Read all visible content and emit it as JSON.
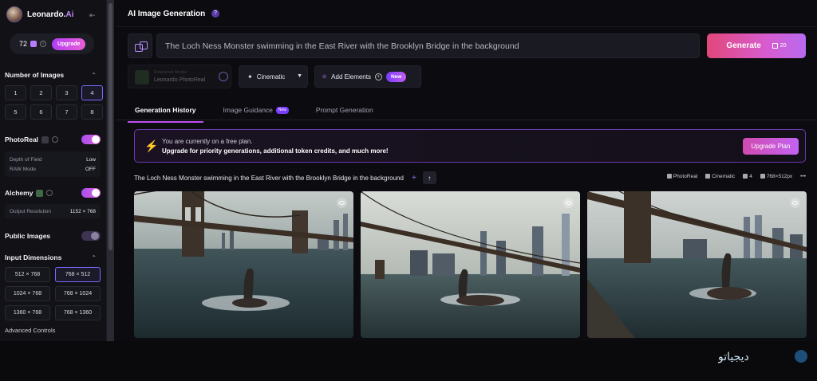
{
  "sidebar": {
    "brand": {
      "name": "Leonardo.",
      "name_ai": "Ai"
    },
    "tokens": {
      "count": "72",
      "upgrade_label": "Upgrade"
    },
    "number_of_images": {
      "title": "Number of Images",
      "options": [
        "1",
        "2",
        "3",
        "4",
        "5",
        "6",
        "7",
        "8"
      ],
      "selected": "4"
    },
    "photoreal": {
      "label": "PhotoReal",
      "enabled": true,
      "depth_of_field": {
        "label": "Depth of Field",
        "value": "Low"
      },
      "raw_mode": {
        "label": "RAW Mode",
        "value": "OFF"
      }
    },
    "alchemy": {
      "label": "Alchemy",
      "enabled": true,
      "output_resolution": {
        "label": "Output Resolution",
        "value": "1152 × 768"
      }
    },
    "public_images": {
      "label": "Public Images",
      "enabled": false
    },
    "input_dimensions": {
      "title": "Input Dimensions",
      "options": [
        "512 × 768",
        "768 × 512",
        "1024 × 768",
        "768 × 1024",
        "1360 × 768",
        "768 × 1360"
      ],
      "selected": "768 × 512"
    },
    "advanced_controls": "Advanced Controls"
  },
  "header": {
    "title": "AI Image Generation"
  },
  "prompt": {
    "text": "The Loch Ness Monster swimming in the East River with the Brooklyn Bridge in the background",
    "generate_label": "Generate",
    "generate_cost": "20"
  },
  "toolbar": {
    "model_caption": "Finetuned Model",
    "model_name": "Leonardo PhotoReal",
    "style": "Cinematic",
    "add_elements": "Add Elements",
    "new_badge": "New"
  },
  "tabs": [
    {
      "label": "Generation History",
      "active": true
    },
    {
      "label": "Image Guidance",
      "badge": "New"
    },
    {
      "label": "Prompt Generation"
    }
  ],
  "plan_banner": {
    "line1": "You are currently on a free plan.",
    "line2": "Upgrade for priority generations, additional token credits, and much more!",
    "button": "Upgrade Plan"
  },
  "generation": {
    "prompt": "The Loch Ness Monster swimming in the East River with the Brooklyn Bridge in the background",
    "meta": {
      "model": "PhotoReal",
      "style": "Cinematic",
      "count": "4",
      "size": "768×512px"
    }
  },
  "watermark": {
    "text": "دیجیاتو"
  }
}
